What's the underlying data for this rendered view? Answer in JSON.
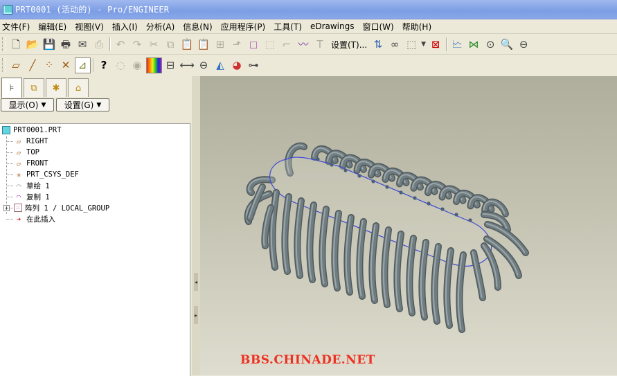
{
  "window": {
    "title": "PRT0001 (活动的) - Pro/ENGINEER"
  },
  "menu": [
    {
      "label": "文件(F)"
    },
    {
      "label": "编辑(E)"
    },
    {
      "label": "视图(V)"
    },
    {
      "label": "插入(I)"
    },
    {
      "label": "分析(A)"
    },
    {
      "label": "信息(N)"
    },
    {
      "label": "应用程序(P)"
    },
    {
      "label": "工具(T)"
    },
    {
      "label": "eDrawings"
    },
    {
      "label": "窗口(W)"
    },
    {
      "label": "帮助(H)"
    }
  ],
  "toolbar": {
    "settings_label": "设置(T)...",
    "icons_row1": [
      "new-file-icon",
      "open-folder-icon",
      "save-icon",
      "print-icon",
      "email-icon",
      "send-icon",
      "undo-icon",
      "redo-icon",
      "cut-icon",
      "copy-icon",
      "paste-icon",
      "paste-special-icon",
      "regenerate-icon",
      "repaint-icon",
      "feature-icon",
      "solid-icon",
      "datum-plane-icon",
      "datum-curve-icon",
      "analysis-icon"
    ],
    "icons_row1_right": [
      "layers-icon",
      "binoculars-icon",
      "selection-box-icon",
      "close-window-icon",
      "orient-icon",
      "datum-network-icon",
      "refit-icon",
      "zoom-in-icon",
      "zoom-out-icon"
    ],
    "icons_row2": [
      "plane-display-icon",
      "axis-display-icon",
      "point-display-icon",
      "csys-display-icon",
      "annotation-display-icon",
      "whats-this-icon",
      "hide-icon",
      "show-icon",
      "color-icon",
      "section-icon",
      "dimension-icon",
      "measure-icon",
      "curvature-icon",
      "appearance-icon",
      "filter-icon"
    ]
  },
  "model_tree": {
    "tabs": [
      "model-tree-tab",
      "layers-tab",
      "favorites-tab",
      "folder-tab"
    ],
    "show_button": "显示(O)",
    "settings_button": "设置(G)",
    "items": [
      {
        "label": "PRT0001.PRT",
        "icon": "part-icon"
      },
      {
        "label": "RIGHT",
        "icon": "datum-plane-icon"
      },
      {
        "label": "TOP",
        "icon": "datum-plane-icon"
      },
      {
        "label": "FRONT",
        "icon": "datum-plane-icon"
      },
      {
        "label": "PRT_CSYS_DEF",
        "icon": "csys-icon"
      },
      {
        "label": "草绘 1",
        "icon": "sketch-icon"
      },
      {
        "label": "复制 1",
        "icon": "copy-feature-icon"
      },
      {
        "label": "阵列 1 / LOCAL_GROUP",
        "icon": "pattern-icon"
      },
      {
        "label": "在此插入",
        "icon": "insert-here-arrow-icon"
      }
    ]
  },
  "graphics": {
    "watermark": "BBS.CHINADE.NET",
    "colors": {
      "background_top": "#afae9d",
      "background_bottom": "#dfddcf",
      "tube": "#6f7c80",
      "sketch": "#3a48d8",
      "watermark": "#ee3020"
    }
  }
}
